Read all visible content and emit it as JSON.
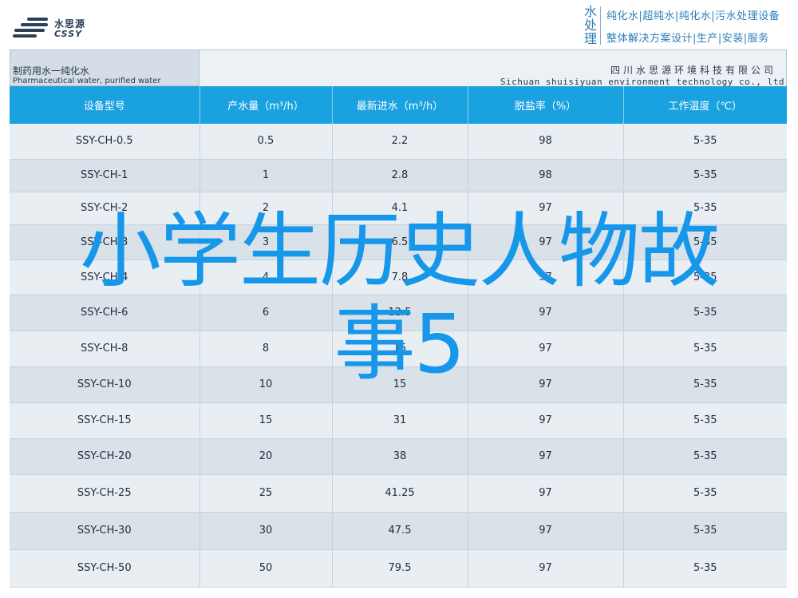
{
  "brand": {
    "name_cn": "水思源",
    "name_en": "CSSY"
  },
  "tagline": {
    "vertical": "水处理",
    "line1": "纯化水|超纯水|纯化水|污水处理设备",
    "line2": "整体解决方案设计|生产|安装|服务"
  },
  "table": {
    "title_cn": "制药用水一纯化水",
    "title_en": "Pharmaceutical water, purified water",
    "company_cn": "四川水思源环境科技有限公司",
    "company_en": "Sichuan shuisiyuan environment technology co., ltd",
    "headers": [
      "设备型号",
      "产水量（m³/h）",
      "最新进水（m³/h）",
      "脱盐率（%）",
      "工作温度（℃）"
    ],
    "rows": [
      [
        "SSY-CH-0.5",
        "0.5",
        "2.2",
        "98",
        "5-35"
      ],
      [
        "SSY-CH-1",
        "1",
        "2.8",
        "98",
        "5-35"
      ],
      [
        "SSY-CH-2",
        "2",
        "4.1",
        "97",
        "5-35"
      ],
      [
        "SSY-CH-3",
        "3",
        "6.5",
        "97",
        "5-35"
      ],
      [
        "SSY-CH-4",
        "4",
        "7.8",
        "97",
        "5-35"
      ],
      [
        "SSY-CH-6",
        "6",
        "12.5",
        "97",
        "5-35"
      ],
      [
        "SSY-CH-8",
        "8",
        "15",
        "97",
        "5-35"
      ],
      [
        "SSY-CH-10",
        "10",
        "15",
        "97",
        "5-35"
      ],
      [
        "SSY-CH-15",
        "15",
        "31",
        "97",
        "5-35"
      ],
      [
        "SSY-CH-20",
        "20",
        "38",
        "97",
        "5-35"
      ],
      [
        "SSY-CH-25",
        "25",
        "41.25",
        "97",
        "5-35"
      ],
      [
        "SSY-CH-30",
        "30",
        "47.5",
        "97",
        "5-35"
      ],
      [
        "SSY-CH-50",
        "50",
        "79.5",
        "97",
        "5-35"
      ]
    ]
  },
  "overlay_text": {
    "line1": "小学生历史人物故",
    "line2": "事5"
  },
  "colors": {
    "header_blue": "#1aa1e0",
    "overlay_blue": "#1697ea",
    "brand_navy": "#2b3f57",
    "tagline_blue": "#2c7fb8"
  }
}
